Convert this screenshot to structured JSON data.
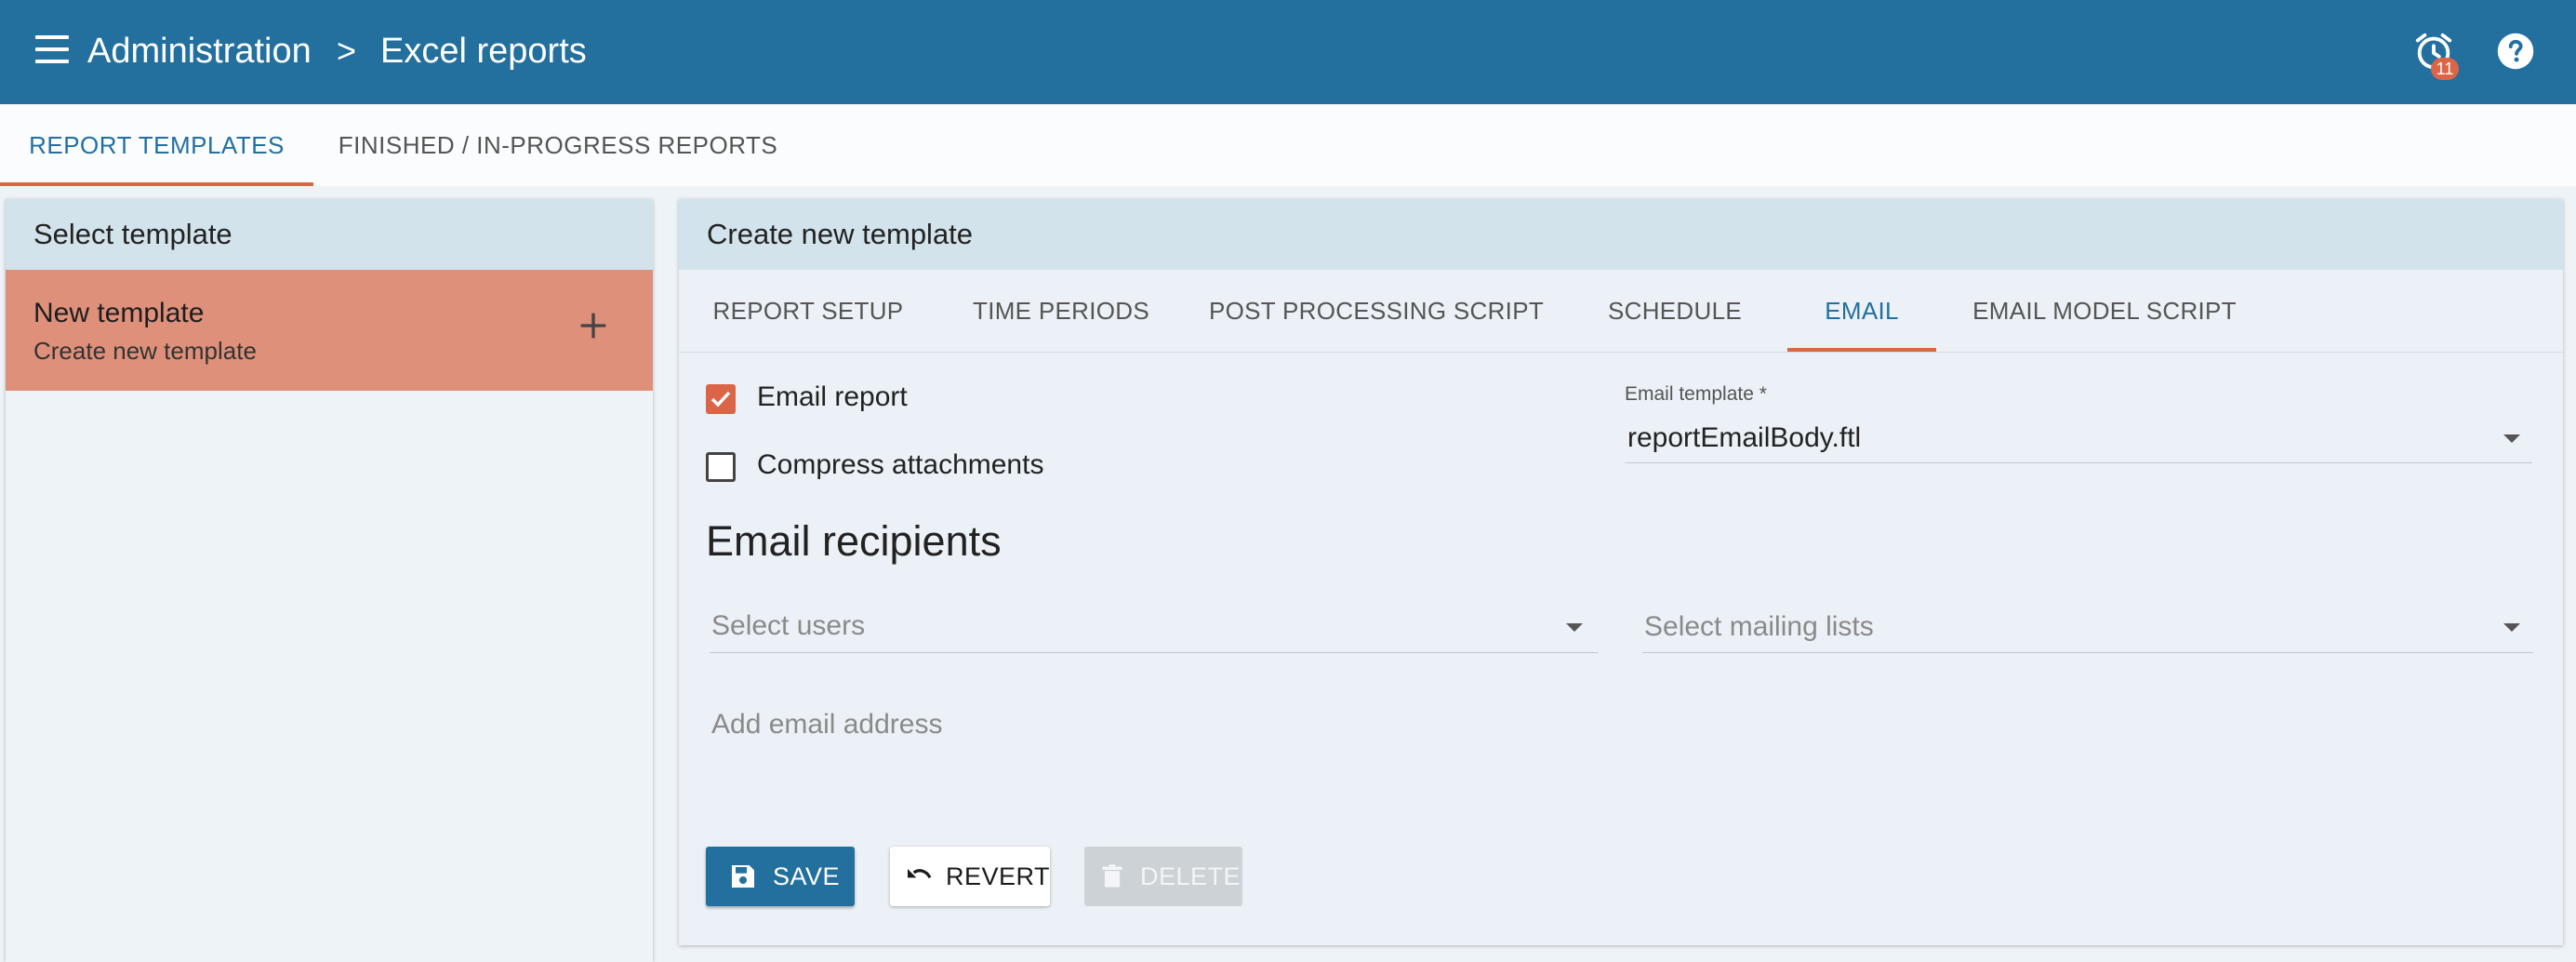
{
  "header": {
    "breadcrumb": [
      "Administration",
      "Excel reports"
    ],
    "breadcrumb_separator": ">",
    "alarm_count": "11",
    "icons": [
      "menu-icon",
      "alarm-clock-icon",
      "help-icon"
    ]
  },
  "main_tabs": [
    {
      "label": "REPORT TEMPLATES",
      "active": true
    },
    {
      "label": "FINISHED / IN-PROGRESS REPORTS",
      "active": false
    }
  ],
  "left_panel": {
    "title": "Select template",
    "items": [
      {
        "name": "New template",
        "description": "Create new template"
      }
    ]
  },
  "right_panel": {
    "title": "Create new template",
    "tabs": [
      {
        "label": "REPORT SETUP",
        "active": false
      },
      {
        "label": "TIME PERIODS",
        "active": false
      },
      {
        "label": "POST PROCESSING SCRIPT",
        "active": false
      },
      {
        "label": "SCHEDULE",
        "active": false
      },
      {
        "label": "EMAIL",
        "active": true
      },
      {
        "label": "EMAIL MODEL SCRIPT",
        "active": false
      }
    ],
    "email_report": {
      "label": "Email report",
      "checked": true
    },
    "compress_attachments": {
      "label": "Compress attachments",
      "checked": false
    },
    "email_template": {
      "label": "Email template *",
      "value": "reportEmailBody.ftl"
    },
    "recipients_title": "Email recipients",
    "select_users_placeholder": "Select users",
    "select_mailing_lists_placeholder": "Select mailing lists",
    "add_email_placeholder": "Add email address",
    "buttons": {
      "save": "SAVE",
      "revert": "REVERT",
      "delete": "DELETE"
    }
  },
  "colors": {
    "primary": "#23709f",
    "accent": "#dc6447",
    "selected_item": "#de907a",
    "panel_header": "#d3e3eb"
  }
}
